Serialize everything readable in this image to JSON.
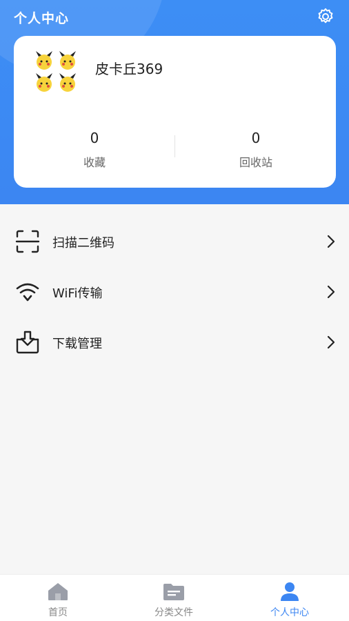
{
  "header": {
    "title": "个人中心"
  },
  "profile": {
    "username": "皮卡丘369"
  },
  "stats": [
    {
      "value": "0",
      "label": "收藏"
    },
    {
      "value": "0",
      "label": "回收站"
    }
  ],
  "menu": [
    {
      "label": "扫描二维码",
      "icon": "scan-icon"
    },
    {
      "label": "WiFi传输",
      "icon": "wifi-icon"
    },
    {
      "label": "下载管理",
      "icon": "download-box-icon"
    }
  ],
  "tabs": [
    {
      "label": "首页",
      "icon": "home-icon",
      "active": false
    },
    {
      "label": "分类文件",
      "icon": "folder-icon",
      "active": false
    },
    {
      "label": "个人中心",
      "icon": "person-icon",
      "active": true
    }
  ],
  "colors": {
    "accent": "#3c86f2",
    "header_bg": "#3d8ef5"
  }
}
